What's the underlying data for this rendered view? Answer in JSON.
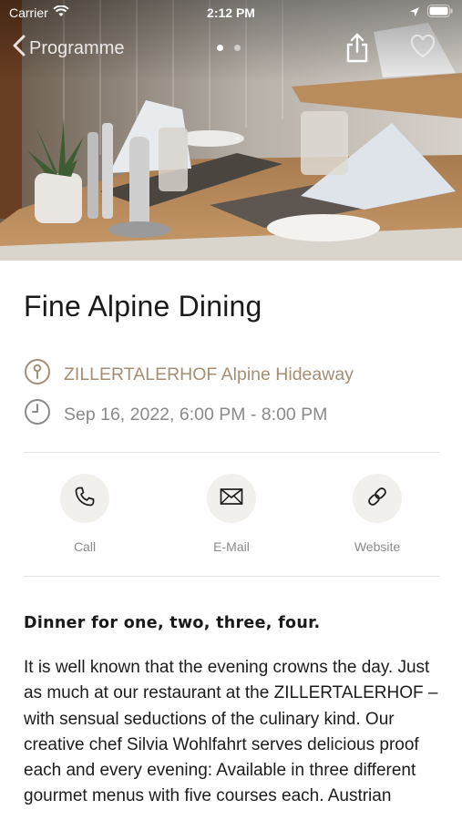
{
  "status_bar": {
    "carrier": "Carrier",
    "time": "2:12 PM"
  },
  "nav": {
    "back_label": "Programme",
    "page_count": 2,
    "active_page": 1
  },
  "event": {
    "title": "Fine Alpine Dining",
    "location": "ZILLERTALERHOF Alpine Hideaway",
    "date": "Sep 16, 2022, 6:00 PM - 8:00 PM"
  },
  "actions": [
    {
      "label": "Call",
      "icon": "phone-icon"
    },
    {
      "label": "E-Mail",
      "icon": "mail-icon"
    },
    {
      "label": "Website",
      "icon": "link-icon"
    }
  ],
  "description": {
    "heading": "Dinner for one, two, three, four.",
    "text": "It is well known that the evening crowns the day. Just as much at our restaurant at the ZILLERTALERHOF – with sensual seductions of the culinary kind. Our creative chef Silvia Wohlfahrt serves delicious proof each and every evening: Available in three different gourmet menus with five courses each. Austrian"
  },
  "colors": {
    "accent": "#a48f74",
    "muted": "#8a8a8a",
    "circle_bg": "#f2f0ed"
  }
}
